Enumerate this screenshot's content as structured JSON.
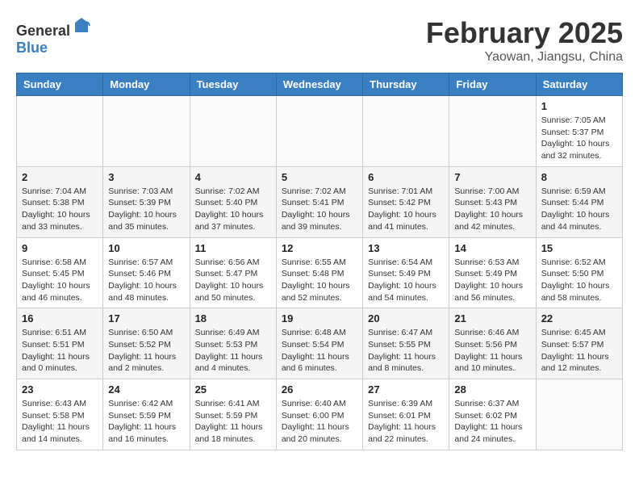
{
  "header": {
    "logo_general": "General",
    "logo_blue": "Blue",
    "month": "February 2025",
    "location": "Yaowan, Jiangsu, China"
  },
  "weekdays": [
    "Sunday",
    "Monday",
    "Tuesday",
    "Wednesday",
    "Thursday",
    "Friday",
    "Saturday"
  ],
  "weeks": [
    [
      {
        "day": "",
        "info": ""
      },
      {
        "day": "",
        "info": ""
      },
      {
        "day": "",
        "info": ""
      },
      {
        "day": "",
        "info": ""
      },
      {
        "day": "",
        "info": ""
      },
      {
        "day": "",
        "info": ""
      },
      {
        "day": "1",
        "info": "Sunrise: 7:05 AM\nSunset: 5:37 PM\nDaylight: 10 hours and 32 minutes."
      }
    ],
    [
      {
        "day": "2",
        "info": "Sunrise: 7:04 AM\nSunset: 5:38 PM\nDaylight: 10 hours and 33 minutes."
      },
      {
        "day": "3",
        "info": "Sunrise: 7:03 AM\nSunset: 5:39 PM\nDaylight: 10 hours and 35 minutes."
      },
      {
        "day": "4",
        "info": "Sunrise: 7:02 AM\nSunset: 5:40 PM\nDaylight: 10 hours and 37 minutes."
      },
      {
        "day": "5",
        "info": "Sunrise: 7:02 AM\nSunset: 5:41 PM\nDaylight: 10 hours and 39 minutes."
      },
      {
        "day": "6",
        "info": "Sunrise: 7:01 AM\nSunset: 5:42 PM\nDaylight: 10 hours and 41 minutes."
      },
      {
        "day": "7",
        "info": "Sunrise: 7:00 AM\nSunset: 5:43 PM\nDaylight: 10 hours and 42 minutes."
      },
      {
        "day": "8",
        "info": "Sunrise: 6:59 AM\nSunset: 5:44 PM\nDaylight: 10 hours and 44 minutes."
      }
    ],
    [
      {
        "day": "9",
        "info": "Sunrise: 6:58 AM\nSunset: 5:45 PM\nDaylight: 10 hours and 46 minutes."
      },
      {
        "day": "10",
        "info": "Sunrise: 6:57 AM\nSunset: 5:46 PM\nDaylight: 10 hours and 48 minutes."
      },
      {
        "day": "11",
        "info": "Sunrise: 6:56 AM\nSunset: 5:47 PM\nDaylight: 10 hours and 50 minutes."
      },
      {
        "day": "12",
        "info": "Sunrise: 6:55 AM\nSunset: 5:48 PM\nDaylight: 10 hours and 52 minutes."
      },
      {
        "day": "13",
        "info": "Sunrise: 6:54 AM\nSunset: 5:49 PM\nDaylight: 10 hours and 54 minutes."
      },
      {
        "day": "14",
        "info": "Sunrise: 6:53 AM\nSunset: 5:49 PM\nDaylight: 10 hours and 56 minutes."
      },
      {
        "day": "15",
        "info": "Sunrise: 6:52 AM\nSunset: 5:50 PM\nDaylight: 10 hours and 58 minutes."
      }
    ],
    [
      {
        "day": "16",
        "info": "Sunrise: 6:51 AM\nSunset: 5:51 PM\nDaylight: 11 hours and 0 minutes."
      },
      {
        "day": "17",
        "info": "Sunrise: 6:50 AM\nSunset: 5:52 PM\nDaylight: 11 hours and 2 minutes."
      },
      {
        "day": "18",
        "info": "Sunrise: 6:49 AM\nSunset: 5:53 PM\nDaylight: 11 hours and 4 minutes."
      },
      {
        "day": "19",
        "info": "Sunrise: 6:48 AM\nSunset: 5:54 PM\nDaylight: 11 hours and 6 minutes."
      },
      {
        "day": "20",
        "info": "Sunrise: 6:47 AM\nSunset: 5:55 PM\nDaylight: 11 hours and 8 minutes."
      },
      {
        "day": "21",
        "info": "Sunrise: 6:46 AM\nSunset: 5:56 PM\nDaylight: 11 hours and 10 minutes."
      },
      {
        "day": "22",
        "info": "Sunrise: 6:45 AM\nSunset: 5:57 PM\nDaylight: 11 hours and 12 minutes."
      }
    ],
    [
      {
        "day": "23",
        "info": "Sunrise: 6:43 AM\nSunset: 5:58 PM\nDaylight: 11 hours and 14 minutes."
      },
      {
        "day": "24",
        "info": "Sunrise: 6:42 AM\nSunset: 5:59 PM\nDaylight: 11 hours and 16 minutes."
      },
      {
        "day": "25",
        "info": "Sunrise: 6:41 AM\nSunset: 5:59 PM\nDaylight: 11 hours and 18 minutes."
      },
      {
        "day": "26",
        "info": "Sunrise: 6:40 AM\nSunset: 6:00 PM\nDaylight: 11 hours and 20 minutes."
      },
      {
        "day": "27",
        "info": "Sunrise: 6:39 AM\nSunset: 6:01 PM\nDaylight: 11 hours and 22 minutes."
      },
      {
        "day": "28",
        "info": "Sunrise: 6:37 AM\nSunset: 6:02 PM\nDaylight: 11 hours and 24 minutes."
      },
      {
        "day": "",
        "info": ""
      }
    ]
  ]
}
